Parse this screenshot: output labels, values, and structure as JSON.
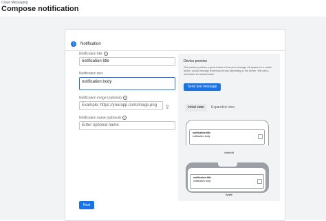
{
  "header": {
    "breadcrumb": "Cloud Messaging",
    "title": "Compose notification"
  },
  "card": {
    "step_number": "1",
    "step_title": "Notification"
  },
  "form": {
    "title_label": "Notification title",
    "title_value": "notification title",
    "text_label": "Notification text",
    "text_value": "notification body",
    "image_label": "Notification image (optional)",
    "image_placeholder": "Example: https://yourapp.com/image.png",
    "name_label": "Notification name (optional)",
    "name_placeholder": "Enter optional name",
    "next_label": "Next"
  },
  "preview": {
    "title": "Device preview",
    "description": "This preview provides a general idea of how your message will appear on a mobile device. Actual message rendering will vary depending on the device. Test with a real device for actual results.",
    "send_test_label": "Send test message",
    "tabs": [
      {
        "label": "Initial state",
        "active": true
      },
      {
        "label": "Expanded view",
        "active": false
      }
    ],
    "android_label": "Android",
    "apple_label": "Apple",
    "notif_title": "notification title",
    "notif_body": "notification body"
  },
  "icons": {
    "help": "help-circle-icon",
    "upload": "upload-icon",
    "image": "image-icon"
  },
  "colors": {
    "accent": "#1a73e8",
    "background": "#f1f3f4"
  }
}
